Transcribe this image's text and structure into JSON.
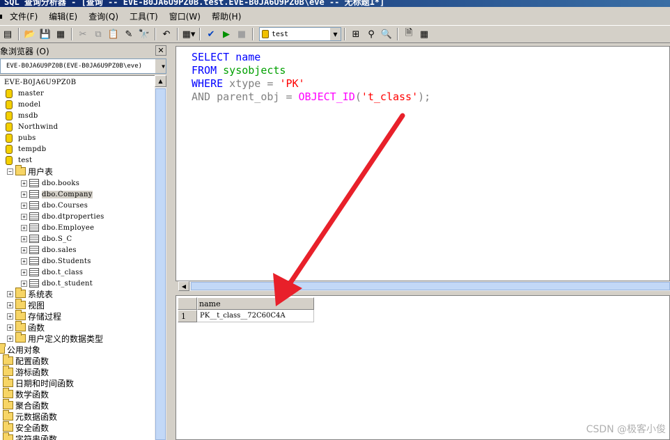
{
  "window": {
    "title": "SQL 查询分析器 - [查询 -- EVE-B0JA6U9PZ0B.test.EVE-B0JA6U9PZ0B\\eve -- 无标题1*]"
  },
  "menu": {
    "items": [
      "文件(F)",
      "编辑(E)",
      "查询(Q)",
      "工具(T)",
      "窗口(W)",
      "帮助(H)"
    ]
  },
  "toolbar": {
    "database": "test",
    "icons": [
      "new-query-icon",
      "open-icon",
      "save-icon",
      "insert-template-icon",
      "cut-icon",
      "copy-icon",
      "paste-icon",
      "clear-icon",
      "find-icon",
      "undo-icon",
      "results-mode-icon",
      "parse-icon",
      "execute-icon",
      "stop-icon",
      "object-browser-icon",
      "object-search-icon",
      "show-plan-icon",
      "properties-icon",
      "results-grid-icon"
    ]
  },
  "object_browser": {
    "title": "象浏览器 (O)",
    "server": "EVE-B0JA6U9PZ0B(EVE-B0JA6U9PZ0B\\eve)",
    "root": "EVE-B0JA6U9PZ0B",
    "databases": [
      "master",
      "model",
      "msdb",
      "Northwind",
      "pubs",
      "tempdb",
      "test"
    ],
    "user_tables_label": "用户表",
    "tables": [
      "dbo.books",
      "dbo.Company",
      "dbo.Courses",
      "dbo.dtproperties",
      "dbo.Employee",
      "dbo.S_C",
      "dbo.sales",
      "dbo.Students",
      "dbo.t_class",
      "dbo.t_student"
    ],
    "selected_table": "dbo.Company",
    "test_folders": [
      "系统表",
      "视图",
      "存储过程",
      "函数",
      "用户定义的数据类型"
    ],
    "public_objects_label": "公用对象",
    "public_folders": [
      "配置函数",
      "游标函数",
      "日期和时间函数",
      "数学函数",
      "聚合函数",
      "元数据函数",
      "安全函数",
      "字符串函数"
    ]
  },
  "editor": {
    "line1_kw": "SELECT",
    "line1_rest": " name",
    "line2_kw": "FROM",
    "line2_obj": " sysobjects",
    "line3_kw": "WHERE",
    "line3_rest": " xtype = ",
    "line3_str": "'PK'",
    "line4_kw": "AND",
    "line4_rest": " parent_obj = ",
    "line4_fn": "OBJECT_ID",
    "line4_open": "(",
    "line4_str": "'t_class'",
    "line4_close": ");"
  },
  "results": {
    "columns": [
      "name"
    ],
    "rows": [
      {
        "num": "1",
        "values": [
          "PK__t_class__72C60C4A"
        ]
      }
    ]
  },
  "annotation": {
    "arrow_color": "#e8202a"
  },
  "watermark": "CSDN @极客小俊"
}
